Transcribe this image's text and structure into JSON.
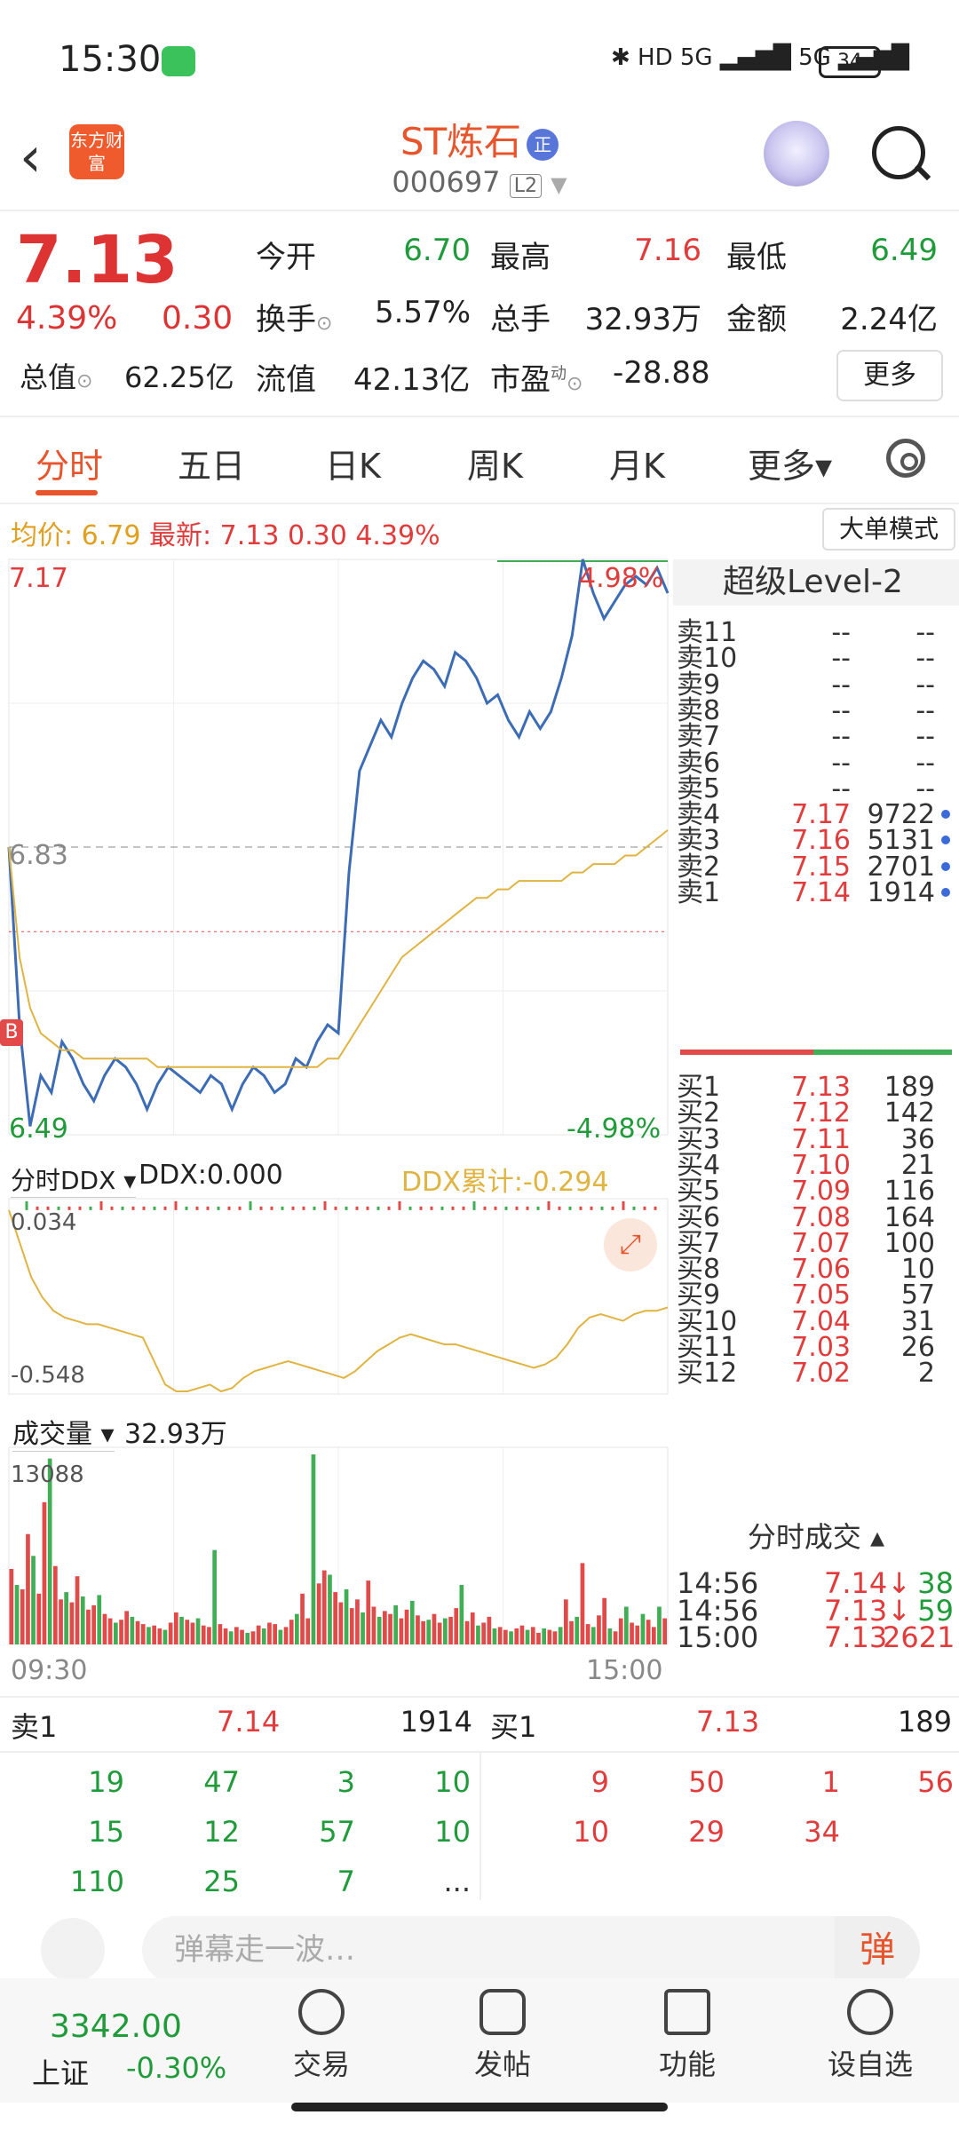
{
  "status_bar": {
    "time": "15:30",
    "icons_text": "✱ HD 5G ▂▄▆█ 5G ▂▄▆█",
    "battery": "34"
  },
  "header": {
    "back_icon": "‹",
    "logo_text": "东方财富",
    "title": "ST炼石",
    "title_badge": "正",
    "code": "000697",
    "level": "L2"
  },
  "quote": {
    "price": "7.13",
    "change_pct": "4.39%",
    "change": "0.30",
    "rows": [
      [
        {
          "k": "今开",
          "v": "6.70",
          "c": "green"
        },
        {
          "k": "最高",
          "v": "7.16",
          "c": "red"
        },
        {
          "k": "最低",
          "v": "6.49",
          "c": "green"
        }
      ],
      [
        {
          "k": "换手",
          "v": "5.57%",
          "c": "dark"
        },
        {
          "k": "总手",
          "v": "32.93万",
          "c": "dark"
        },
        {
          "k": "金额",
          "v": "2.24亿",
          "c": "dark"
        }
      ]
    ],
    "zongzhi_label": "总值",
    "zongzhi": "62.25亿",
    "liuzhi_label": "流值",
    "liuzhi": "42.13亿",
    "shiying_label": "市盈",
    "shiying_sup": "动",
    "shiying": "-28.88",
    "more": "更多"
  },
  "tabs": {
    "items": [
      "分时",
      "五日",
      "日K",
      "周K",
      "月K",
      "更多▾"
    ],
    "active": 0
  },
  "infoline": {
    "avg_label": "均价:",
    "avg": "6.79",
    "latest_label": "最新:",
    "latest": "7.13",
    "chg": "0.30",
    "pct": "4.39%",
    "mode_button": "大单模式"
  },
  "chart_labels": {
    "y_high": "7.17",
    "y_mid": "6.83",
    "y_low": "6.49",
    "pct_high": "4.98%",
    "pct_low": "-4.98%",
    "b_marker": "B",
    "ddx_selector": "分时DDX ▾",
    "ddx_value": "DDX:0.000",
    "ddx_cum": "DDX累计:-0.294",
    "ddx_top": "0.034",
    "ddx_bottom": "-0.548",
    "vol_selector": "成交量 ▾",
    "vol_value": "32.93万",
    "vol_max": "13088",
    "x_start": "09:30",
    "x_end": "15:00"
  },
  "chart_data": [
    {
      "type": "line",
      "title": "",
      "y_labels": [
        "7.17",
        "6.83",
        "6.49"
      ],
      "ylim": [
        6.49,
        7.17
      ],
      "x_labels": [
        "09:30",
        "15:00"
      ],
      "series": [
        {
          "role": "price",
          "color": "#3b6cb5",
          "values": [
            6.83,
            6.62,
            6.5,
            6.56,
            6.54,
            6.6,
            6.58,
            6.55,
            6.53,
            6.56,
            6.58,
            6.57,
            6.55,
            6.52,
            6.55,
            6.57,
            6.56,
            6.55,
            6.54,
            6.56,
            6.55,
            6.52,
            6.55,
            6.57,
            6.56,
            6.54,
            6.55,
            6.58,
            6.57,
            6.6,
            6.62,
            6.61,
            6.8,
            6.92,
            6.95,
            6.98,
            6.96,
            7.0,
            7.03,
            7.05,
            7.04,
            7.02,
            7.06,
            7.05,
            7.03,
            7.0,
            7.01,
            6.98,
            6.96,
            6.99,
            6.97,
            6.99,
            7.03,
            7.08,
            7.17,
            7.13,
            7.1,
            7.12,
            7.14,
            7.15,
            7.14,
            7.16,
            7.13
          ]
        },
        {
          "role": "average",
          "color": "#e0b440",
          "values": [
            6.83,
            6.7,
            6.64,
            6.61,
            6.6,
            6.59,
            6.59,
            6.58,
            6.58,
            6.58,
            6.58,
            6.58,
            6.58,
            6.58,
            6.57,
            6.57,
            6.57,
            6.57,
            6.57,
            6.57,
            6.57,
            6.57,
            6.57,
            6.57,
            6.57,
            6.57,
            6.57,
            6.57,
            6.57,
            6.57,
            6.58,
            6.58,
            6.6,
            6.62,
            6.64,
            6.66,
            6.68,
            6.7,
            6.71,
            6.72,
            6.73,
            6.74,
            6.75,
            6.76,
            6.77,
            6.77,
            6.78,
            6.78,
            6.79,
            6.79,
            6.79,
            6.79,
            6.79,
            6.8,
            6.8,
            6.81,
            6.81,
            6.81,
            6.82,
            6.82,
            6.83,
            6.84,
            6.85
          ]
        }
      ]
    },
    {
      "type": "line",
      "title": "分时DDX",
      "ylim": [
        -0.548,
        0.034
      ],
      "series": [
        {
          "name": "DDX累计",
          "color": "#e0b440",
          "values": [
            0.0,
            -0.1,
            -0.2,
            -0.26,
            -0.3,
            -0.32,
            -0.33,
            -0.34,
            -0.34,
            -0.35,
            -0.36,
            -0.37,
            -0.38,
            -0.45,
            -0.52,
            -0.54,
            -0.54,
            -0.53,
            -0.52,
            -0.54,
            -0.53,
            -0.5,
            -0.48,
            -0.47,
            -0.46,
            -0.45,
            -0.46,
            -0.47,
            -0.48,
            -0.49,
            -0.5,
            -0.48,
            -0.45,
            -0.42,
            -0.4,
            -0.38,
            -0.37,
            -0.38,
            -0.39,
            -0.4,
            -0.4,
            -0.41,
            -0.42,
            -0.43,
            -0.44,
            -0.45,
            -0.46,
            -0.47,
            -0.46,
            -0.44,
            -0.4,
            -0.35,
            -0.32,
            -0.31,
            -0.32,
            -0.33,
            -0.31,
            -0.3,
            -0.3,
            -0.29
          ]
        }
      ]
    },
    {
      "type": "bar",
      "title": "成交量",
      "ylim": [
        0,
        13088
      ],
      "values": [
        5200,
        4100,
        3800,
        7600,
        6100,
        3500,
        9800,
        12800,
        5400,
        3100,
        3600,
        2900,
        4700,
        3300,
        2400,
        2700,
        3400,
        2100,
        1800,
        1500,
        1700,
        2300,
        1900,
        1600,
        1400,
        1200,
        1300,
        1100,
        1000,
        1500,
        2200,
        1900,
        1700,
        1500,
        1800,
        1300,
        1200,
        6500,
        1400,
        1100,
        900,
        1200,
        1000,
        800,
        900,
        1300,
        1100,
        1500,
        1400,
        1000,
        1200,
        1700,
        2100,
        3500,
        1800,
        13088,
        4200,
        5100,
        4800,
        3600,
        2900,
        3800,
        2500,
        3100,
        2200,
        4400,
        2600,
        1900,
        2300,
        2100,
        2700,
        1800,
        2400,
        3000,
        2000,
        1600,
        1700,
        2100,
        1500,
        1800,
        1900,
        2500,
        4100,
        1600,
        2200,
        1300,
        1500,
        1900,
        1100,
        1200,
        1000,
        900,
        1100,
        1300,
        1000,
        1200,
        800,
        1100,
        1000,
        900,
        1200,
        3100,
        1600,
        1900,
        5600,
        1400,
        1200,
        2000,
        3200,
        1100,
        900,
        1800,
        2600,
        1500,
        1300,
        2100,
        1700,
        1200,
        2600,
        1800
      ]
    }
  ],
  "book": {
    "header": "超级Level-2",
    "sells": [
      {
        "n": "卖11",
        "p": "--",
        "v": "--"
      },
      {
        "n": "卖10",
        "p": "--",
        "v": "--"
      },
      {
        "n": "卖9",
        "p": "--",
        "v": "--"
      },
      {
        "n": "卖8",
        "p": "--",
        "v": "--"
      },
      {
        "n": "卖7",
        "p": "--",
        "v": "--"
      },
      {
        "n": "卖6",
        "p": "--",
        "v": "--"
      },
      {
        "n": "卖5",
        "p": "--",
        "v": "--"
      },
      {
        "n": "卖4",
        "p": "7.17",
        "v": "9722"
      },
      {
        "n": "卖3",
        "p": "7.16",
        "v": "5131"
      },
      {
        "n": "卖2",
        "p": "7.15",
        "v": "2701"
      },
      {
        "n": "卖1",
        "p": "7.14",
        "v": "1914"
      }
    ],
    "buys": [
      {
        "n": "买1",
        "p": "7.13",
        "v": "189"
      },
      {
        "n": "买2",
        "p": "7.12",
        "v": "142"
      },
      {
        "n": "买3",
        "p": "7.11",
        "v": "36"
      },
      {
        "n": "买4",
        "p": "7.10",
        "v": "21"
      },
      {
        "n": "买5",
        "p": "7.09",
        "v": "116"
      },
      {
        "n": "买6",
        "p": "7.08",
        "v": "164"
      },
      {
        "n": "买7",
        "p": "7.07",
        "v": "100"
      },
      {
        "n": "买8",
        "p": "7.06",
        "v": "10"
      },
      {
        "n": "买9",
        "p": "7.05",
        "v": "57"
      },
      {
        "n": "买10",
        "p": "7.04",
        "v": "31"
      },
      {
        "n": "买11",
        "p": "7.03",
        "v": "26"
      },
      {
        "n": "买12",
        "p": "7.02",
        "v": "2"
      }
    ],
    "ticks_header": "分时成交 ▴",
    "ticks": [
      {
        "t": "14:56",
        "p": "7.14↓",
        "v": "38",
        "c": "green"
      },
      {
        "t": "14:56",
        "p": "7.13↓",
        "v": "59",
        "c": "green"
      },
      {
        "t": "15:00",
        "p": "7.13",
        "v": "2621",
        "c": "red"
      }
    ]
  },
  "queue": {
    "sell_label": "卖1",
    "sell_price": "7.14",
    "sell_total": "1914",
    "buy_label": "买1",
    "buy_price": "7.13",
    "buy_total": "189",
    "sell_rows": [
      [
        "19",
        "47",
        "3",
        "10"
      ],
      [
        "15",
        "12",
        "57",
        "10"
      ],
      [
        "110",
        "25",
        "7",
        "..."
      ]
    ],
    "buy_rows": [
      [
        "9",
        "50",
        "1",
        "56"
      ],
      [
        "10",
        "29",
        "34",
        ""
      ]
    ]
  },
  "danmu": {
    "placeholder": "弹幕走一波…",
    "button": "弹"
  },
  "bottom_nav": {
    "index_value": "3342.00",
    "index_name": "上证",
    "index_pct": "-0.30%",
    "items": [
      "交易",
      "发帖",
      "功能",
      "设自选"
    ]
  }
}
